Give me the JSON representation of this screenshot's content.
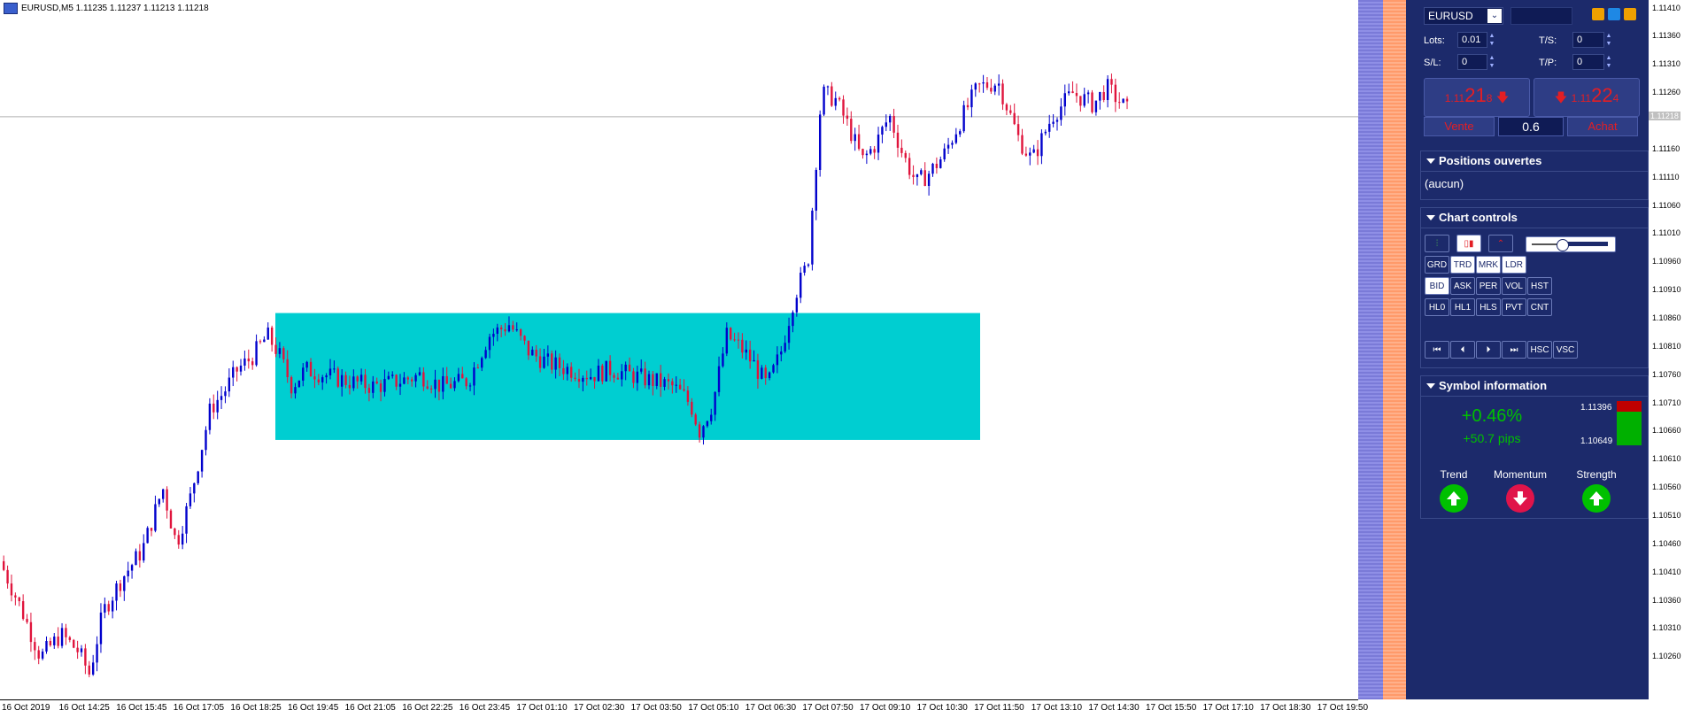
{
  "chart_title": "EURUSD,M5  1.11235 1.11237 1.11213 1.11218",
  "chart_data": {
    "type": "candlestick",
    "symbol": "EURUSD",
    "timeframe": "M5",
    "ohlc_header": {
      "open": 1.11235,
      "high": 1.11237,
      "low": 1.11213,
      "close": 1.11218
    },
    "y_range": [
      1.10185,
      1.11425
    ],
    "current_price": 1.11218,
    "x_tick_labels": [
      "16 Oct 2019",
      "16 Oct 14:25",
      "16 Oct 15:45",
      "16 Oct 17:05",
      "16 Oct 18:25",
      "16 Oct 19:45",
      "16 Oct 21:05",
      "16 Oct 22:25",
      "16 Oct 23:45",
      "17 Oct 01:10",
      "17 Oct 02:30",
      "17 Oct 03:50",
      "17 Oct 05:10",
      "17 Oct 06:30",
      "17 Oct 07:50",
      "17 Oct 09:10",
      "17 Oct 10:30",
      "17 Oct 11:50",
      "17 Oct 13:10",
      "17 Oct 14:30",
      "17 Oct 15:50",
      "17 Oct 17:10",
      "17 Oct 18:30",
      "17 Oct 19:50"
    ],
    "y_tick_labels": [
      "1.11410",
      "1.11360",
      "1.11310",
      "1.11260",
      "1.11218",
      "1.11160",
      "1.11110",
      "1.11060",
      "1.11010",
      "1.10960",
      "1.10910",
      "1.10860",
      "1.10810",
      "1.10760",
      "1.10710",
      "1.10660",
      "1.10610",
      "1.10560",
      "1.10510",
      "1.10460",
      "1.10410",
      "1.10360",
      "1.10310",
      "1.10260"
    ],
    "price_path": [
      [
        0,
        1.1043
      ],
      [
        0.015,
        1.1035
      ],
      [
        0.03,
        1.1026
      ],
      [
        0.045,
        1.103
      ],
      [
        0.058,
        1.1027
      ],
      [
        0.066,
        1.1023
      ],
      [
        0.076,
        1.1034
      ],
      [
        0.09,
        1.104
      ],
      [
        0.105,
        1.1045
      ],
      [
        0.12,
        1.1056
      ],
      [
        0.13,
        1.1046
      ],
      [
        0.14,
        1.1054
      ],
      [
        0.155,
        1.107
      ],
      [
        0.165,
        1.1073
      ],
      [
        0.175,
        1.1077
      ],
      [
        0.185,
        1.1079
      ],
      [
        0.197,
        1.1083
      ],
      [
        0.205,
        1.108
      ],
      [
        0.215,
        1.1074
      ],
      [
        0.225,
        1.1077
      ],
      [
        0.24,
        1.1076
      ],
      [
        0.255,
        1.1075
      ],
      [
        0.275,
        1.1074
      ],
      [
        0.295,
        1.1075
      ],
      [
        0.31,
        1.1076
      ],
      [
        0.325,
        1.1074
      ],
      [
        0.345,
        1.1075
      ],
      [
        0.36,
        1.1083
      ],
      [
        0.375,
        1.1085
      ],
      [
        0.39,
        1.108
      ],
      [
        0.405,
        1.1078
      ],
      [
        0.42,
        1.1077
      ],
      [
        0.435,
        1.1076
      ],
      [
        0.45,
        1.1077
      ],
      [
        0.465,
        1.1076
      ],
      [
        0.48,
        1.1075
      ],
      [
        0.495,
        1.1074
      ],
      [
        0.505,
        1.1072
      ],
      [
        0.51,
        1.107
      ],
      [
        0.515,
        1.1066
      ],
      [
        0.525,
        1.1071
      ],
      [
        0.535,
        1.1083
      ],
      [
        0.545,
        1.1081
      ],
      [
        0.555,
        1.1078
      ],
      [
        0.565,
        1.1074
      ],
      [
        0.575,
        1.108
      ],
      [
        0.585,
        1.109
      ],
      [
        0.595,
        1.1096
      ],
      [
        0.605,
        1.1126
      ],
      [
        0.615,
        1.1125
      ],
      [
        0.625,
        1.112
      ],
      [
        0.635,
        1.1114
      ],
      [
        0.645,
        1.1117
      ],
      [
        0.655,
        1.1122
      ],
      [
        0.665,
        1.1115
      ],
      [
        0.675,
        1.111
      ],
      [
        0.685,
        1.1112
      ],
      [
        0.695,
        1.1115
      ],
      [
        0.705,
        1.112
      ],
      [
        0.72,
        1.1127
      ],
      [
        0.735,
        1.1128
      ],
      [
        0.75,
        1.1118
      ],
      [
        0.76,
        1.1114
      ],
      [
        0.775,
        1.1122
      ],
      [
        0.79,
        1.1126
      ],
      [
        0.805,
        1.1124
      ],
      [
        0.815,
        1.1127
      ],
      [
        0.83,
        1.1123
      ]
    ]
  },
  "panel": {
    "symbol": "EURUSD",
    "lots_label": "Lots:",
    "lots_value": "0.01",
    "sl_label": "S/L:",
    "sl_value": "0",
    "ts_label": "T/S:",
    "ts_value": "0",
    "tp_label": "T/P:",
    "tp_value": "0",
    "sell_prefix": "1.11",
    "sell_big": "21",
    "sell_small": "8",
    "sell_label": "Vente",
    "buy_prefix": "1.11",
    "buy_big": "22",
    "buy_small": "4",
    "buy_label": "Achat",
    "spread": "0.6",
    "positions_title": "Positions ouvertes",
    "positions_value": "(aucun)",
    "chart_controls_title": "Chart controls",
    "controls_row2": [
      "GRD",
      "TRD",
      "MRK",
      "LDR"
    ],
    "controls_row3": [
      "BID",
      "ASK",
      "PER",
      "VOL",
      "HST"
    ],
    "controls_row4": [
      "HL0",
      "HL1",
      "HLS",
      "PVT",
      "CNT"
    ],
    "controls_row5_text": [
      "HSC",
      "VSC"
    ],
    "symbol_info_title": "Symbol information",
    "change_percent": "+0.46%",
    "change_pips": "+50.7 pips",
    "range_high": "1.11396",
    "range_low": "1.10649",
    "range_position": 0.76,
    "trend_label": "Trend",
    "momentum_label": "Momentum",
    "strength_label": "Strength",
    "trend_direction": "up",
    "momentum_direction": "down",
    "strength_direction": "up"
  },
  "colors": {
    "bull": "#0000cc",
    "bear": "#e0143c",
    "range_box": "#00ced1",
    "panel_bg": "#1c2a6b",
    "up_green": "#00c000",
    "down_red": "#e0144a"
  }
}
